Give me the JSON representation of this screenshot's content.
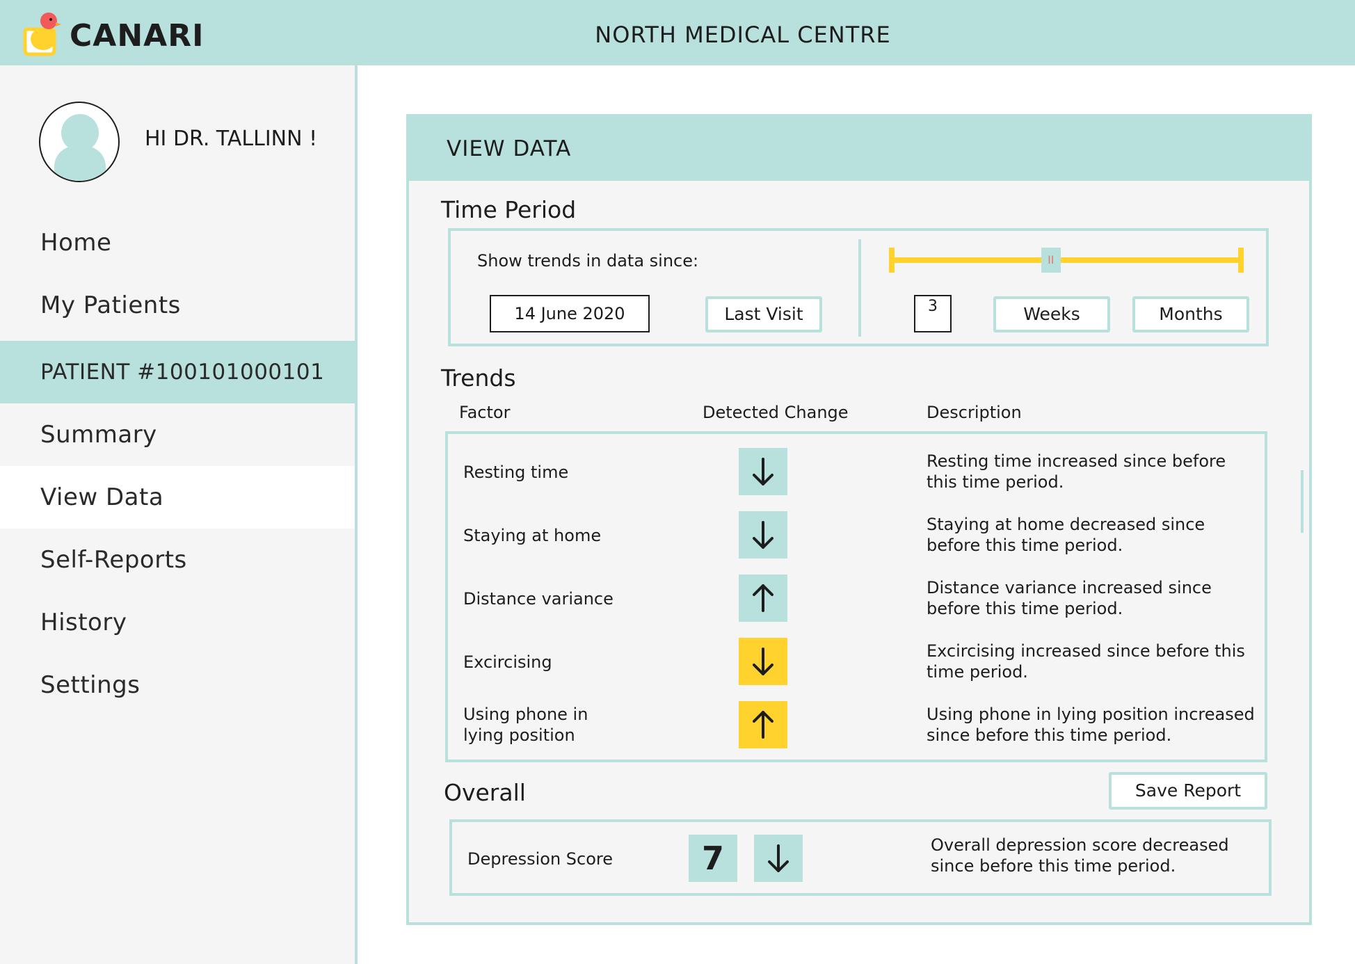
{
  "header": {
    "brand": "CANARI",
    "clinic": "NORTH MEDICAL CENTRE",
    "logo_icon": "canari-bird-logo",
    "colors": {
      "accent": "#b8e1de",
      "warning": "#ffd22e",
      "logo_bird": "#f25a5a"
    }
  },
  "sidebar": {
    "greeting": "HI DR. TALLINN !",
    "avatar_icon": "user-avatar-icon",
    "items": [
      {
        "label": "Home"
      },
      {
        "label": "My Patients"
      },
      {
        "label": "PATIENT #100101000101"
      },
      {
        "label": "Summary"
      },
      {
        "label": "View Data"
      },
      {
        "label": "Self-Reports"
      },
      {
        "label": "History"
      },
      {
        "label": "Settings"
      }
    ]
  },
  "main": {
    "title": "VIEW DATA",
    "time_period": {
      "heading": "Time Period",
      "prompt": "Show trends in data since:",
      "date_value": "14 June 2020",
      "last_visit_label": "Last Visit",
      "count_value": "3",
      "weeks_label": "Weeks",
      "months_label": "Months",
      "slider_thumb_glyph": "II",
      "slider_position": 0.45
    },
    "trends": {
      "heading": "Trends",
      "columns": {
        "factor": "Factor",
        "change": "Detected Change",
        "description": "Description"
      },
      "rows": [
        {
          "factor": "Resting time",
          "direction": "down",
          "color": "#b8e1de",
          "description": "Resting time increased since before this time period."
        },
        {
          "factor": "Staying at home",
          "direction": "down",
          "color": "#b8e1de",
          "description": "Staying at home decreased since before this time period."
        },
        {
          "factor": "Distance variance",
          "direction": "up",
          "color": "#b8e1de",
          "description": "Distance variance increased since before this time period."
        },
        {
          "factor": "Excircising",
          "direction": "down",
          "color": "#ffd22e",
          "description": "Excircising increased since before this time period."
        },
        {
          "factor": "Using phone in lying position",
          "direction": "up",
          "color": "#ffd22e",
          "description": "Using phone in lying position increased since before this time period."
        }
      ]
    },
    "overall": {
      "heading": "Overall",
      "save_label": "Save Report",
      "score_label": "Depression Score",
      "score_value": "7",
      "score_direction": "down",
      "description": "Overall depression score decreased since before this time period."
    }
  }
}
